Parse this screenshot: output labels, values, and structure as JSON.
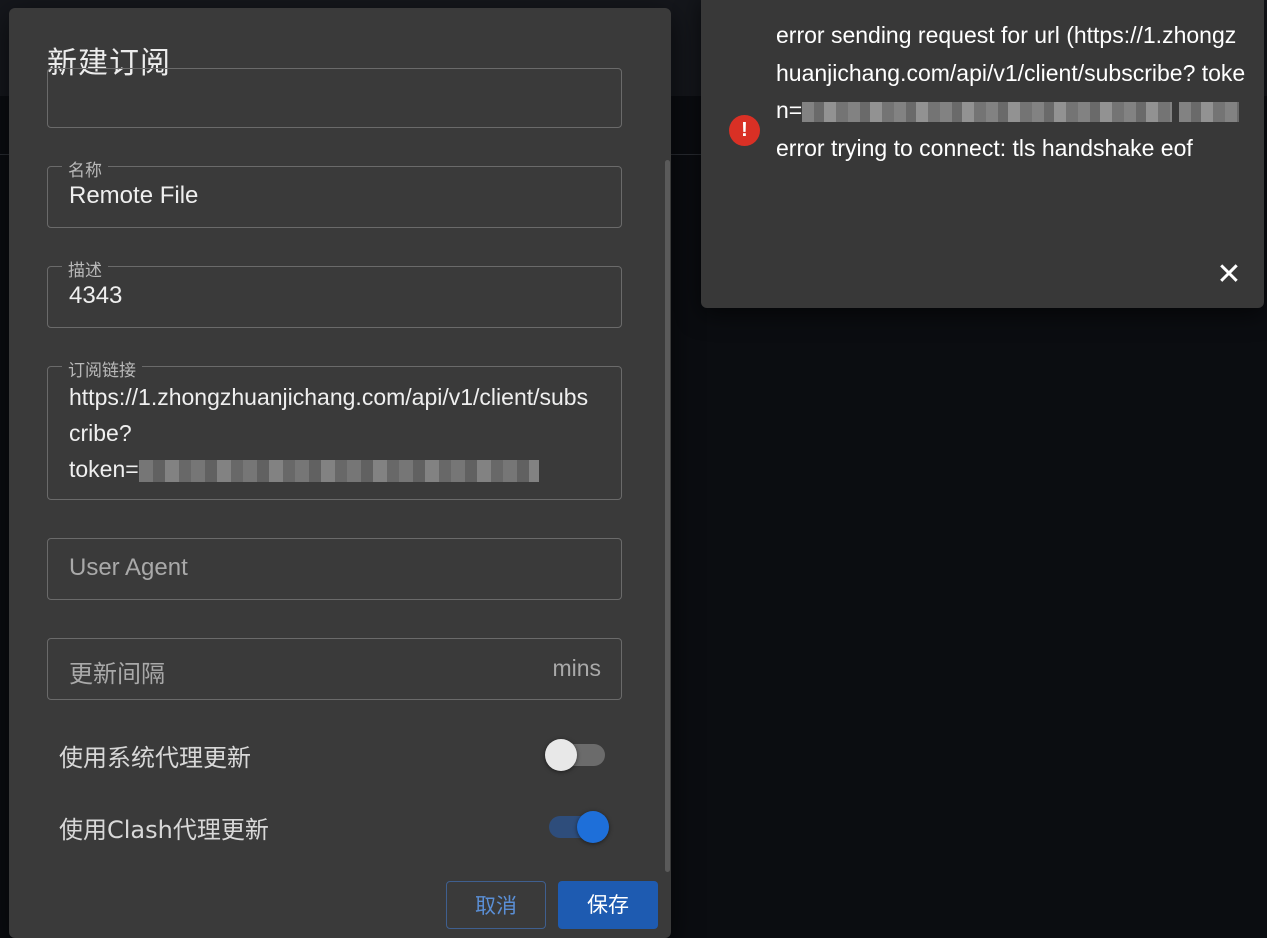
{
  "dialog": {
    "title": "新建订阅",
    "fields": {
      "name": {
        "label": "名称",
        "value": "Remote File"
      },
      "desc": {
        "label": "描述",
        "value": "4343"
      },
      "url": {
        "label": "订阅链接",
        "value_visible": "https://1.zhongzhuanjichang.com/api/v1/client/subscribe?",
        "token_prefix": "token="
      },
      "user_agent": {
        "placeholder": "User Agent"
      },
      "interval": {
        "placeholder": "更新间隔",
        "suffix": "mins"
      }
    },
    "switches": {
      "system_proxy": {
        "label": "使用系统代理更新",
        "state": "off"
      },
      "clash_proxy": {
        "label": "使用Clash代理更新",
        "state": "on"
      }
    },
    "buttons": {
      "cancel": "取消",
      "save": "保存"
    }
  },
  "toast": {
    "severity": "error",
    "line1": "error sending request for url (https://1.zhongzhuanjichang.com/api/v1/client/subscribe?",
    "token_prefix": "token=",
    "line_tail": "error trying to connect: tls handshake eof",
    "icon": "error-icon",
    "close_icon": "close-icon"
  },
  "colors": {
    "dialog_bg": "#3a3a3a",
    "accent": "#1e6fd9",
    "error": "#d93025"
  }
}
